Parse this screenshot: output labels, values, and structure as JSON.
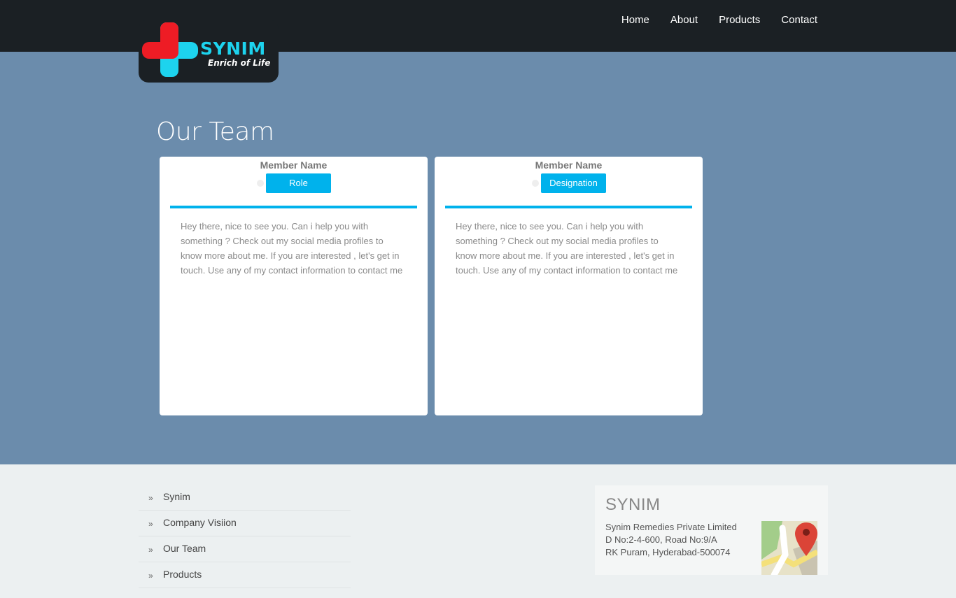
{
  "header": {
    "brand_name": "SYNIM",
    "tagline": "Enrich of Life",
    "nav": [
      "Home",
      "About",
      "Products",
      "Contact"
    ]
  },
  "main": {
    "title": "Our Team",
    "members": [
      {
        "name": "Member Name",
        "role": "Role",
        "bio": "Hey there, nice to see you. Can i help you with something ? Check out my social media profiles to know more about me. If you are interested , let's get in touch. Use any of my contact information to contact me"
      },
      {
        "name": "Member Name",
        "role": "Designation",
        "bio": "Hey there, nice to see you. Can i help you with something ? Check out my social media profiles to know more about me. If you are interested , let's get in touch. Use any of my contact information to contact me"
      }
    ]
  },
  "footer": {
    "links": [
      "Synim",
      "Company Visiion",
      "Our Team",
      "Products"
    ],
    "link_marker": "»",
    "contact": {
      "brand": "SYNIM",
      "address_lines": [
        "Synim Remedies Private Limited",
        "D No:2-4-600, Road No:9/A",
        "RK Puram, Hyderabad-500074"
      ]
    }
  },
  "colors": {
    "header_bg": "#1b2024",
    "page_bg": "#6b8cac",
    "accent": "#00b2ec",
    "logo_red": "#ee1c25",
    "logo_cyan": "#1dd3ee",
    "footer_bg": "#ecf0f1"
  },
  "icons": [
    "synim-cross-logo",
    "google-maps-icon",
    "chevron-double-right-icon"
  ]
}
